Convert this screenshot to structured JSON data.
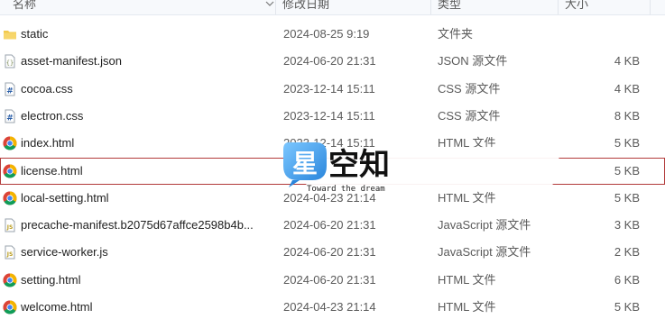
{
  "columns": {
    "name": "名称",
    "date": "修改日期",
    "type": "类型",
    "size": "大小"
  },
  "files": [
    {
      "name": "static",
      "date": "2024-08-25 9:19",
      "type": "文件夹",
      "size": "",
      "icon": "folder-icon"
    },
    {
      "name": "asset-manifest.json",
      "date": "2024-06-20 21:31",
      "type": "JSON 源文件",
      "size": "4 KB",
      "icon": "json-file-icon"
    },
    {
      "name": "cocoa.css",
      "date": "2023-12-14 15:11",
      "type": "CSS 源文件",
      "size": "4 KB",
      "icon": "css-file-icon"
    },
    {
      "name": "electron.css",
      "date": "2023-12-14 15:11",
      "type": "CSS 源文件",
      "size": "8 KB",
      "icon": "css-file-icon"
    },
    {
      "name": "index.html",
      "date": "2023-12-14 15:11",
      "type": "HTML 文件",
      "size": "5 KB",
      "icon": "chrome-icon"
    },
    {
      "name": "license.html",
      "date": "",
      "type": "",
      "size": "5 KB",
      "icon": "chrome-icon",
      "selected": true
    },
    {
      "name": "local-setting.html",
      "date": "2024-04-23 21:14",
      "type": "HTML 文件",
      "size": "5 KB",
      "icon": "chrome-icon"
    },
    {
      "name": "precache-manifest.b2075d67affce2598b4b...",
      "date": "2024-06-20 21:31",
      "type": "JavaScript 源文件",
      "size": "3 KB",
      "icon": "js-file-icon"
    },
    {
      "name": "service-worker.js",
      "date": "2024-06-20 21:31",
      "type": "JavaScript 源文件",
      "size": "2 KB",
      "icon": "js-file-icon"
    },
    {
      "name": "setting.html",
      "date": "2024-06-20 21:31",
      "type": "HTML 文件",
      "size": "6 KB",
      "icon": "chrome-icon"
    },
    {
      "name": "welcome.html",
      "date": "2024-04-23 21:14",
      "type": "HTML 文件",
      "size": "5 KB",
      "icon": "chrome-icon"
    }
  ],
  "watermark": {
    "logo_char": "星",
    "title": "空知",
    "tagline": "Toward the dream"
  },
  "colors": {
    "header_bg": "#f7f9fc",
    "selection_border": "#b23a3a",
    "folder": "#f2c94c",
    "watermark_blue": "#3a9be6"
  }
}
